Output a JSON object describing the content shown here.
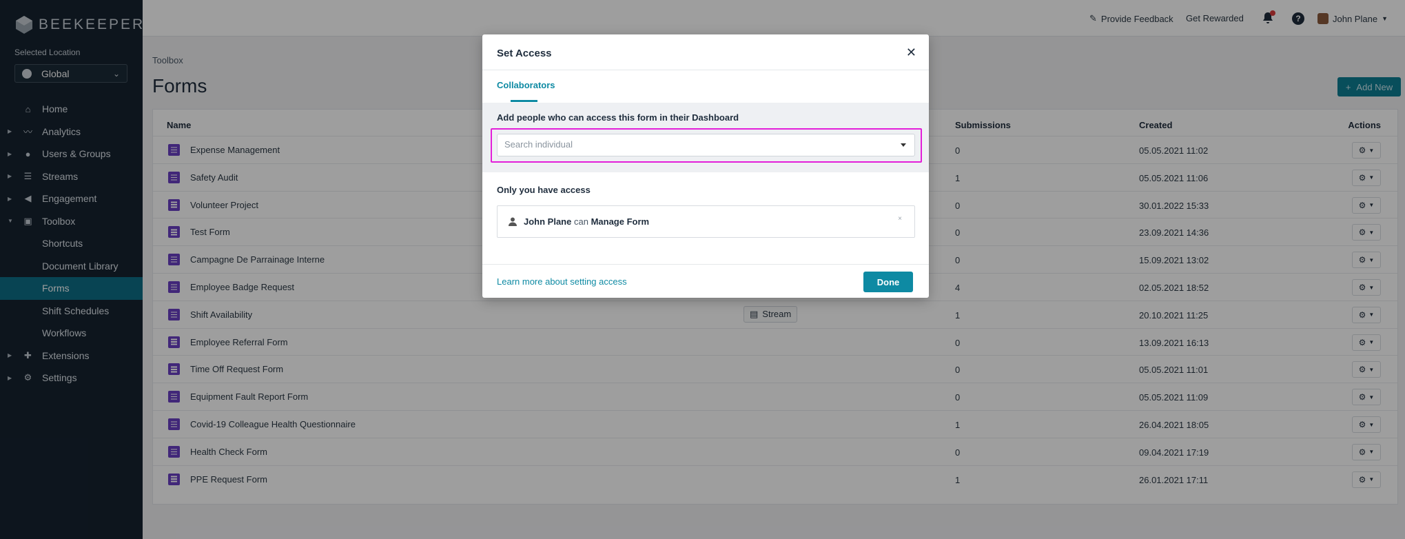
{
  "brand": {
    "name": "BEEKEEPER"
  },
  "sidebar": {
    "location_label": "Selected Location",
    "location_value": "Global",
    "items": [
      {
        "label": "Home",
        "icon": "home-icon",
        "caret": false
      },
      {
        "label": "Analytics",
        "icon": "analytics-icon",
        "caret": true
      },
      {
        "label": "Users & Groups",
        "icon": "users-icon",
        "caret": true
      },
      {
        "label": "Streams",
        "icon": "streams-icon",
        "caret": true
      },
      {
        "label": "Engagement",
        "icon": "megaphone-icon",
        "caret": true
      },
      {
        "label": "Toolbox",
        "icon": "toolbox-icon",
        "caret": true,
        "expanded": true
      },
      {
        "label": "Shortcuts",
        "sub": true
      },
      {
        "label": "Document Library",
        "sub": true
      },
      {
        "label": "Forms",
        "sub": true,
        "active": true
      },
      {
        "label": "Shift Schedules",
        "sub": true
      },
      {
        "label": "Workflows",
        "sub": true
      },
      {
        "label": "Extensions",
        "icon": "puzzle-icon",
        "caret": true
      },
      {
        "label": "Settings",
        "icon": "gear-icon",
        "caret": true
      }
    ]
  },
  "topbar": {
    "feedback": "Provide Feedback",
    "rewarded": "Get Rewarded",
    "user": "John Plane"
  },
  "page": {
    "breadcrumb": "Toolbox",
    "title": "Forms",
    "add_button": "Add New"
  },
  "table": {
    "columns": {
      "name": "Name",
      "submissions": "Submissions",
      "created": "Created",
      "actions": "Actions"
    },
    "rows": [
      {
        "name": "Expense Management",
        "submissions": "0",
        "created": "05.05.2021 11:02"
      },
      {
        "name": "Safety Audit",
        "submissions": "1",
        "created": "05.05.2021 11:06"
      },
      {
        "name": "Volunteer Project",
        "submissions": "0",
        "created": "30.01.2022 15:33"
      },
      {
        "name": "Test Form",
        "submissions": "0",
        "created": "23.09.2021 14:36"
      },
      {
        "name": "Campagne De Parrainage Interne",
        "submissions": "0",
        "created": "15.09.2021 13:02"
      },
      {
        "name": "Employee Badge Request",
        "submissions": "4",
        "created": "02.05.2021 18:52"
      },
      {
        "name": "Shift Availability",
        "submissions": "1",
        "created": "20.10.2021 11:25",
        "tag": "Stream"
      },
      {
        "name": "Employee Referral Form",
        "submissions": "0",
        "created": "13.09.2021 16:13"
      },
      {
        "name": "Time Off Request Form",
        "submissions": "0",
        "created": "05.05.2021 11:01"
      },
      {
        "name": "Equipment Fault Report Form",
        "submissions": "0",
        "created": "05.05.2021 11:09"
      },
      {
        "name": "Covid-19 Colleague Health Questionnaire",
        "submissions": "1",
        "created": "26.04.2021 18:05"
      },
      {
        "name": "Health Check Form",
        "submissions": "0",
        "created": "09.04.2021 17:19"
      },
      {
        "name": "PPE Request Form",
        "submissions": "1",
        "created": "26.01.2021 17:11"
      }
    ]
  },
  "modal": {
    "title": "Set Access",
    "close": "✕",
    "tab": "Collaborators",
    "add_label": "Add people who can access this form in their Dashboard",
    "search_placeholder": "Search individual",
    "search_value": "",
    "access_label": "Only you have access",
    "access_user": "John Plane",
    "access_can": "can",
    "access_permission": "Manage Form",
    "remove": "×",
    "learn_more": "Learn more about setting access",
    "done": "Done"
  },
  "colors": {
    "sidebar_bg": "#152230",
    "accent": "#0e8aa3",
    "form_icon": "#6a3fc4",
    "highlight": "#e31ed9"
  }
}
